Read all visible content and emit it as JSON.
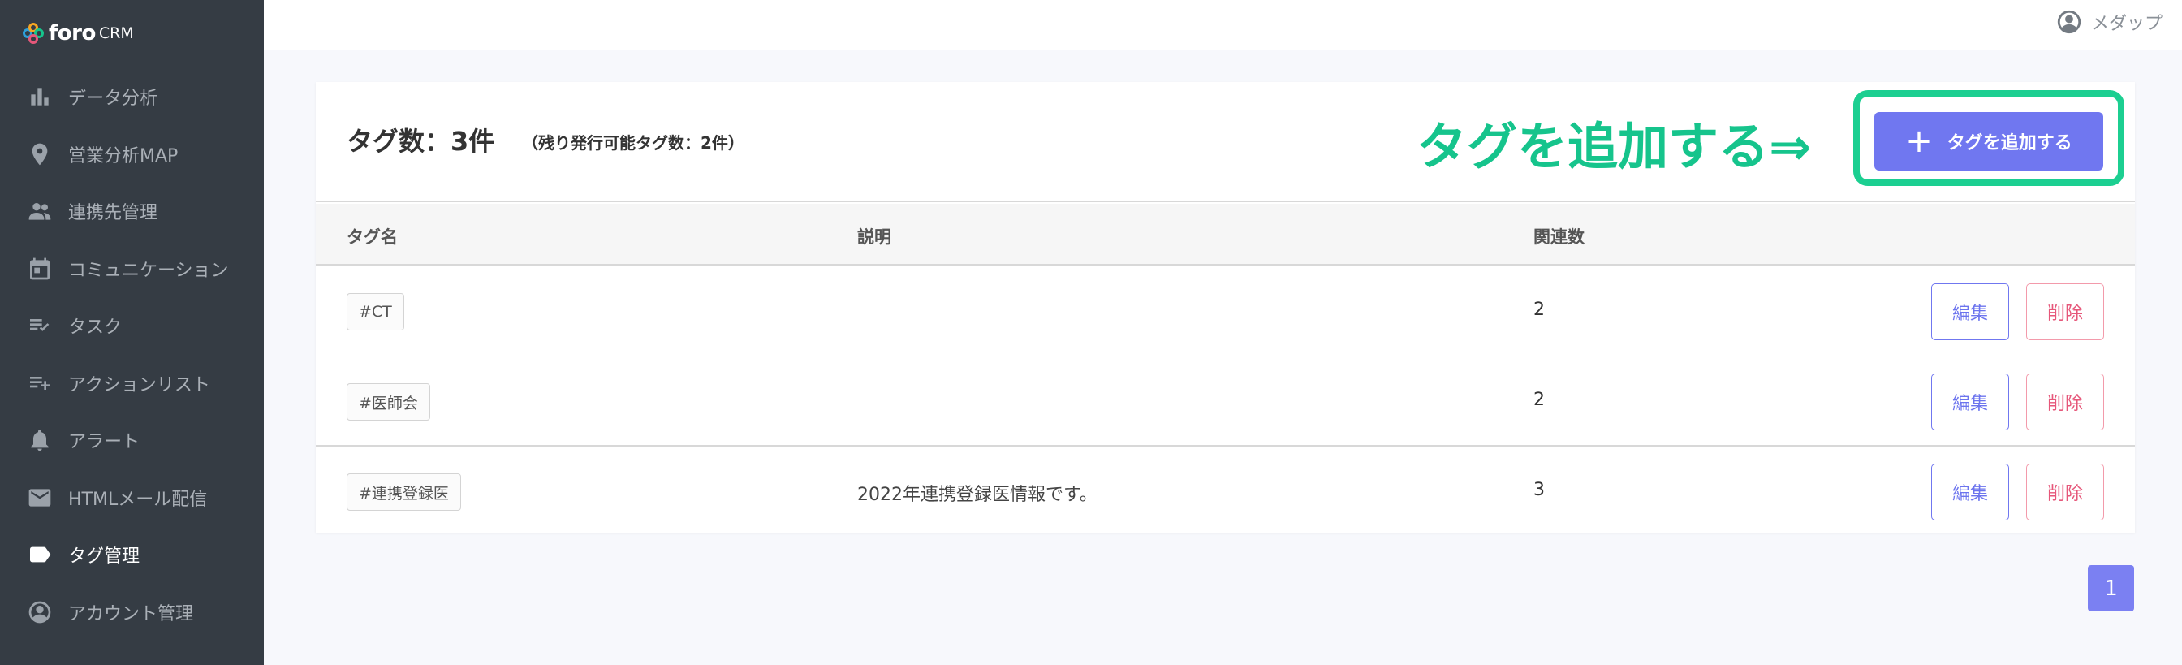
{
  "brand": {
    "name": "foro",
    "suffix": "CRM",
    "colors": [
      "#2e9fd8",
      "#f5a623",
      "#16c48c",
      "#e6577a"
    ]
  },
  "sidebar": {
    "items": [
      {
        "label": "データ分析",
        "icon": "bar-chart-icon"
      },
      {
        "label": "営業分析MAP",
        "icon": "map-pin-icon"
      },
      {
        "label": "連携先管理",
        "icon": "people-icon"
      },
      {
        "label": "コミュニケーション",
        "icon": "calendar-icon"
      },
      {
        "label": "タスク",
        "icon": "checklist-icon"
      },
      {
        "label": "アクションリスト",
        "icon": "playlist-add-icon"
      },
      {
        "label": "アラート",
        "icon": "bell-icon"
      },
      {
        "label": "HTMLメール配信",
        "icon": "mail-icon"
      },
      {
        "label": "タグ管理",
        "icon": "tag-icon",
        "active": true
      },
      {
        "label": "アカウント管理",
        "icon": "account-icon"
      }
    ]
  },
  "header": {
    "user_name": "メダップ"
  },
  "main": {
    "tag_count": "タグ数：3件",
    "remaining": "（残り発行可能タグ数：2件）",
    "annotation": "タグを追加する⇒",
    "add_button": {
      "plus": "+",
      "label": "タグを追加する"
    },
    "table": {
      "headers": {
        "name": "タグ名",
        "description": "説明",
        "count": "関連数"
      },
      "rows": [
        {
          "tag": "#CT",
          "description": "",
          "count": "2"
        },
        {
          "tag": "#医師会",
          "description": "",
          "count": "2"
        },
        {
          "tag": "#連携登録医",
          "description": "2022年連携登録医情報です。",
          "count": "3"
        }
      ],
      "edit_label": "編集",
      "delete_label": "削除"
    },
    "pagination": {
      "current": "1"
    }
  },
  "accent": {
    "primary": "#7077f0",
    "annotation": "#16c48c",
    "danger": "#e6577a",
    "sidebar": "#353c44"
  }
}
